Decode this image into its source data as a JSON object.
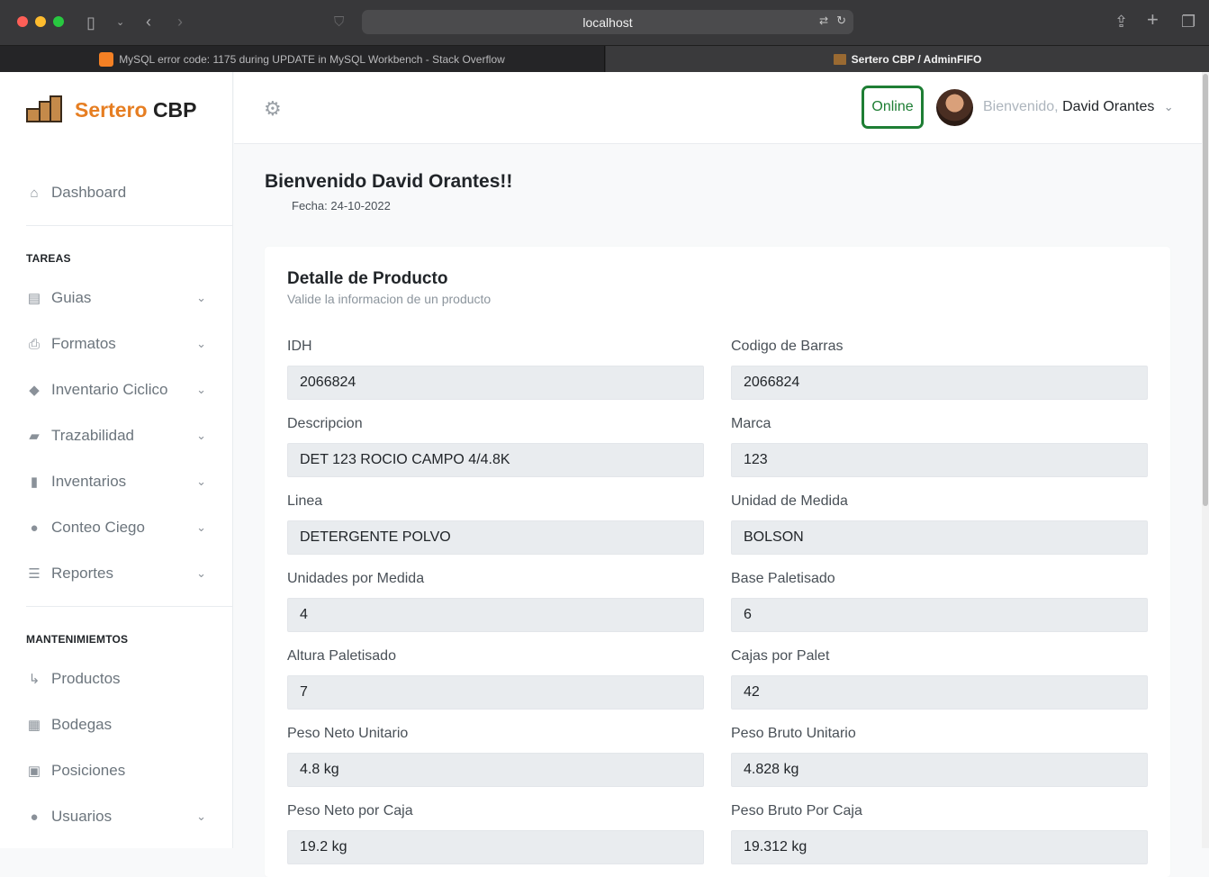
{
  "browser": {
    "url": "localhost",
    "tabs": [
      {
        "title": "MySQL error code: 1175 during UPDATE in MySQL Workbench - Stack Overflow"
      },
      {
        "title": "Sertero CBP / AdminFIFO"
      }
    ]
  },
  "brand": {
    "name_accent": "Sertero",
    "name_rest": "CBP",
    "accent_color": "#e67e22"
  },
  "sidebar": {
    "dashboard": "Dashboard",
    "section_tareas": "TAREAS",
    "tareas": [
      "Guias",
      "Formatos",
      "Inventario Ciclico",
      "Trazabilidad",
      "Inventarios",
      "Conteo Ciego",
      "Reportes"
    ],
    "section_mantenimientos": "MANTENIMIEMTOS",
    "mantenimientos": [
      "Productos",
      "Bodegas",
      "Posiciones",
      "Usuarios"
    ]
  },
  "topbar": {
    "status": "Online",
    "status_color": "#1e7e34",
    "welcome_prefix": "Bienvenido,",
    "user_name": "David Orantes"
  },
  "page": {
    "title": "Bienvenido David Orantes!!",
    "date": "Fecha: 24-10-2022"
  },
  "card": {
    "title": "Detalle de Producto",
    "subtitle": "Valide la informacion de un producto",
    "fields": [
      {
        "label": "IDH",
        "value": "2066824"
      },
      {
        "label": "Codigo de Barras",
        "value": "2066824"
      },
      {
        "label": "Descripcion",
        "value": "DET 123 ROCIO CAMPO 4/4.8K"
      },
      {
        "label": "Marca",
        "value": "123"
      },
      {
        "label": "Linea",
        "value": "DETERGENTE POLVO"
      },
      {
        "label": "Unidad de Medida",
        "value": "BOLSON"
      },
      {
        "label": "Unidades por Medida",
        "value": "4"
      },
      {
        "label": "Base Paletisado",
        "value": "6"
      },
      {
        "label": "Altura Paletisado",
        "value": "7"
      },
      {
        "label": "Cajas por Palet",
        "value": "42"
      },
      {
        "label": "Peso Neto Unitario",
        "value": "4.8 kg"
      },
      {
        "label": "Peso Bruto Unitario",
        "value": "4.828 kg"
      },
      {
        "label": "Peso Neto por Caja",
        "value": "19.2 kg"
      },
      {
        "label": "Peso Bruto Por Caja",
        "value": "19.312 kg"
      }
    ]
  }
}
